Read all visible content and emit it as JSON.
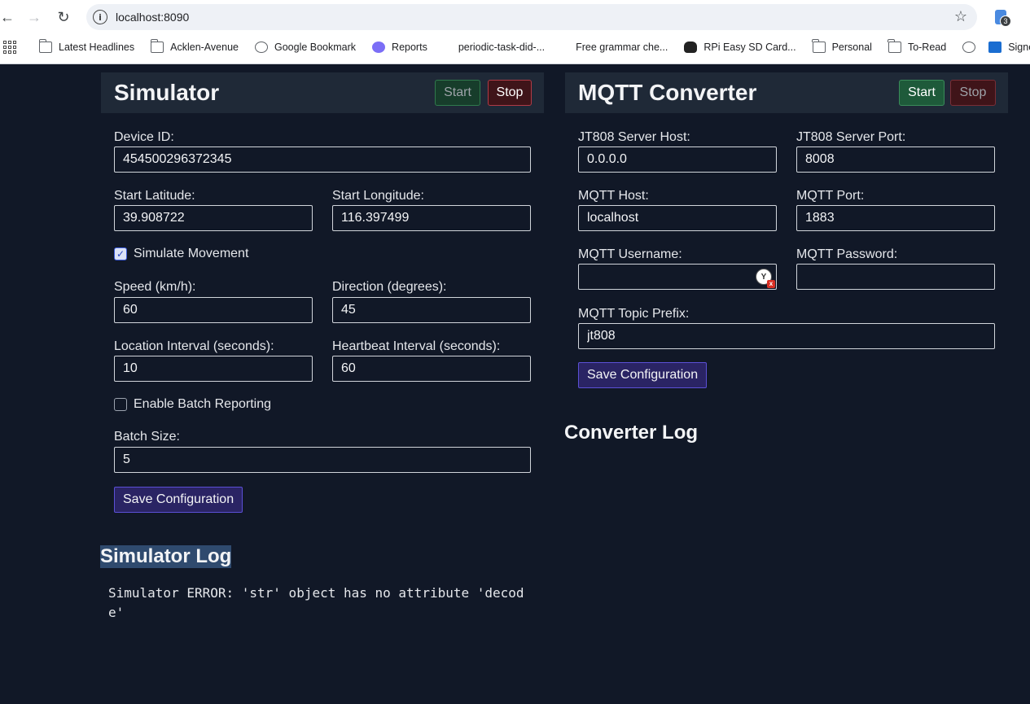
{
  "browser": {
    "url": "localhost:8090",
    "extension_badge": "3",
    "bookmarks": [
      {
        "label": "Latest Headlines",
        "icon": "folder-icon"
      },
      {
        "label": "Acklen-Avenue",
        "icon": "folder-icon"
      },
      {
        "label": "Google Bookmark",
        "icon": "globe-icon"
      },
      {
        "label": "Reports",
        "icon": "reports-icon"
      },
      {
        "label": "periodic-task-did-...",
        "icon": "none"
      },
      {
        "label": "Free grammar che...",
        "icon": "none"
      },
      {
        "label": "RPi Easy SD Card...",
        "icon": "tux-icon"
      },
      {
        "label": "Personal",
        "icon": "folder-icon"
      },
      {
        "label": "To-Read",
        "icon": "folder-icon"
      },
      {
        "label": "",
        "icon": "globe-icon"
      },
      {
        "label": "Signe",
        "icon": "outlook-icon"
      }
    ]
  },
  "simulator": {
    "title": "Simulator",
    "start_label": "Start",
    "stop_label": "Stop",
    "device_id_label": "Device ID:",
    "device_id": "454500296372345",
    "start_lat_label": "Start Latitude:",
    "start_lat": "39.908722",
    "start_lon_label": "Start Longitude:",
    "start_lon": "116.397499",
    "simulate_movement_label": "Simulate Movement",
    "simulate_movement": true,
    "speed_label": "Speed (km/h):",
    "speed": "60",
    "direction_label": "Direction (degrees):",
    "direction": "45",
    "location_interval_label": "Location Interval (seconds):",
    "location_interval": "10",
    "heartbeat_interval_label": "Heartbeat Interval (seconds):",
    "heartbeat_interval": "60",
    "batch_reporting_label": "Enable Batch Reporting",
    "batch_reporting": false,
    "batch_size_label": "Batch Size:",
    "batch_size": "5",
    "save_label": "Save Configuration",
    "log_title": "Simulator Log",
    "log_text": "Simulator ERROR: 'str' object has no attribute 'decode'"
  },
  "converter": {
    "title": "MQTT Converter",
    "start_label": "Start",
    "stop_label": "Stop",
    "jt808_host_label": "JT808 Server Host:",
    "jt808_host": "0.0.0.0",
    "jt808_port_label": "JT808 Server Port:",
    "jt808_port": "8008",
    "mqtt_host_label": "MQTT Host:",
    "mqtt_host": "localhost",
    "mqtt_port_label": "MQTT Port:",
    "mqtt_port": "1883",
    "mqtt_username_label": "MQTT Username:",
    "mqtt_username": "",
    "mqtt_password_label": "MQTT Password:",
    "mqtt_password": "",
    "topic_prefix_label": "MQTT Topic Prefix:",
    "topic_prefix": "jt808",
    "save_label": "Save Configuration",
    "log_title": "Converter Log"
  }
}
